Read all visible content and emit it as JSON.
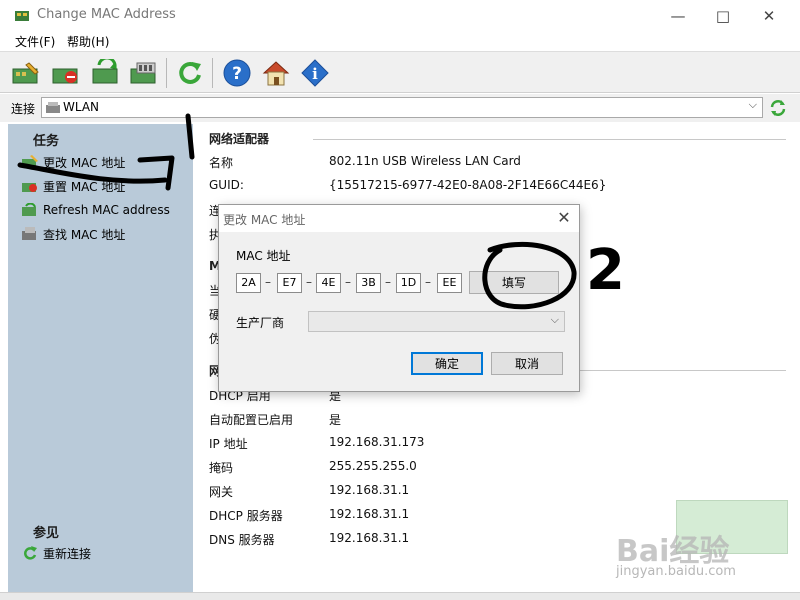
{
  "window": {
    "title": "Change MAC Address"
  },
  "menu": {
    "file": "文件(F)",
    "help": "帮助(H)"
  },
  "toolbar": {
    "buttons": [
      "change-mac-icon",
      "reset-mac-icon",
      "refresh-mac-icon",
      "find-mac-icon",
      "refresh-connection-icon",
      "help-icon",
      "home-icon",
      "info-icon"
    ]
  },
  "connection": {
    "label": "连接",
    "value": "WLAN"
  },
  "tasks": {
    "heading": "任务",
    "items": [
      {
        "label": "更改 MAC 地址"
      },
      {
        "label": "重置 MAC 地址"
      },
      {
        "label": "Refresh MAC address"
      },
      {
        "label": "查找 MAC 地址"
      }
    ]
  },
  "see_also": {
    "heading": "参见",
    "items": [
      {
        "label": "重新连接"
      }
    ]
  },
  "adapter": {
    "title": "网络适配器",
    "name_label": "名称",
    "name_value": "802.11n USB Wireless LAN Card",
    "guid_label": "GUID:",
    "guid_value": "{15517215-6977-42E0-8A08-2F14E66C44E6}",
    "type_label": "连",
    "extra_label": "执",
    "mac_section_label": "M",
    "row1_label": "当",
    "row2_label": "硬",
    "row3_label": "伪",
    "net_section_label": "网"
  },
  "network": {
    "rows": [
      {
        "label": "DHCP 启用",
        "value": "是"
      },
      {
        "label": "自动配置已启用",
        "value": "是"
      },
      {
        "label": "IP 地址",
        "value": "192.168.31.173"
      },
      {
        "label": "掩码",
        "value": "255.255.255.0"
      },
      {
        "label": "网关",
        "value": "192.168.31.1"
      },
      {
        "label": "DHCP 服务器",
        "value": "192.168.31.1"
      },
      {
        "label": "DNS 服务器",
        "value": "192.168.31.1"
      }
    ]
  },
  "dialog": {
    "title": "更改 MAC 地址",
    "mac_label": "MAC 地址",
    "octets": [
      "2A",
      "E7",
      "4E",
      "3B",
      "1D",
      "EE"
    ],
    "fill_button": "填写",
    "vendor_label": "生产厂商",
    "vendor_value": "",
    "ok_button": "确定",
    "cancel_button": "取消"
  },
  "annotation": {
    "step_number": "2"
  },
  "watermark": {
    "brand": "Bai经验",
    "url": "jingyan.baidu.com"
  },
  "colors": {
    "task_pane_bg": "#b9cad9",
    "accent_blue": "#0078d7",
    "ink": "#000000"
  }
}
